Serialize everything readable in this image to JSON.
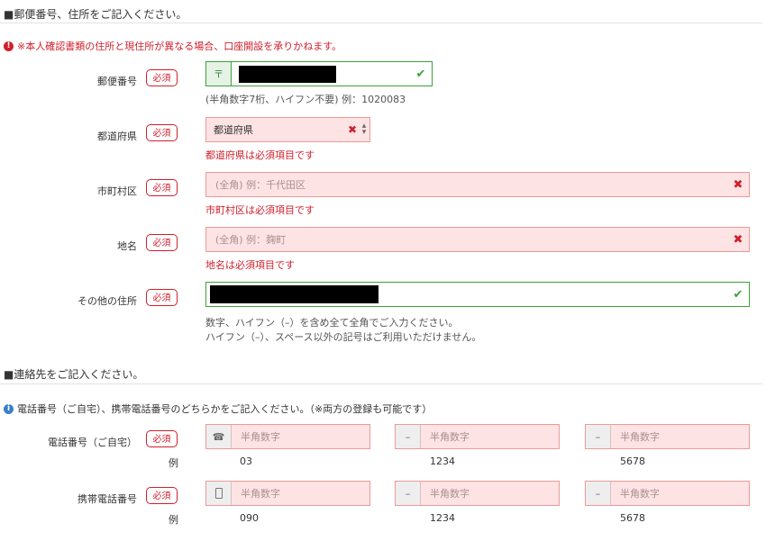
{
  "address_section": {
    "title": "■郵便番号、住所をご記入ください。",
    "warning": "※本人確認書類の住所と現住所が異なる場合、口座開設を承りかねます。",
    "required_label": "必須",
    "postal": {
      "label": "郵便番号",
      "prefix_symbol": "〒",
      "hint": "(半角数字7桁、ハイフン不要) 例：1020083"
    },
    "prefecture": {
      "label": "都道府県",
      "selected": "都道府県",
      "error": "都道府県は必須項目です"
    },
    "city": {
      "label": "市町村区",
      "placeholder": "(全角) 例：千代田区",
      "error": "市町村区は必須項目です"
    },
    "area": {
      "label": "地名",
      "placeholder": "(全角) 例：麹町",
      "error": "地名は必須項目です"
    },
    "other": {
      "label": "その他の住所",
      "hint_line1": "数字、ハイフン（–）を含め全て全角でご入力ください。",
      "hint_line2": "ハイフン（–）、スペース以外の記号はご利用いただけません。"
    }
  },
  "contact_section": {
    "title": "■連絡先をご記入ください。",
    "info": "電話番号（ご自宅）、携帯電話番号のどちらかをご記入ください。（※両方の登録も可能です）",
    "required_label": "必須",
    "placeholder": "半角数字",
    "dash": "–",
    "home_phone": {
      "label": "電話番号（ご自宅）",
      "example_label": "例",
      "examples": [
        "03",
        "1234",
        "5678"
      ]
    },
    "mobile_phone": {
      "label": "携帯電話番号",
      "example_label": "例",
      "examples": [
        "090",
        "1234",
        "5678"
      ]
    }
  },
  "icons": {
    "warning": "exclamation-circle-icon",
    "info": "info-circle-icon",
    "valid": "check-icon",
    "invalid": "x-icon",
    "phone": "phone-icon",
    "mobile": "mobile-icon",
    "select": "select-arrows-icon"
  },
  "colors": {
    "error": "#d0202c",
    "error_bg": "#fde3e3",
    "valid": "#3aa23a",
    "info": "#3a7fc8"
  }
}
